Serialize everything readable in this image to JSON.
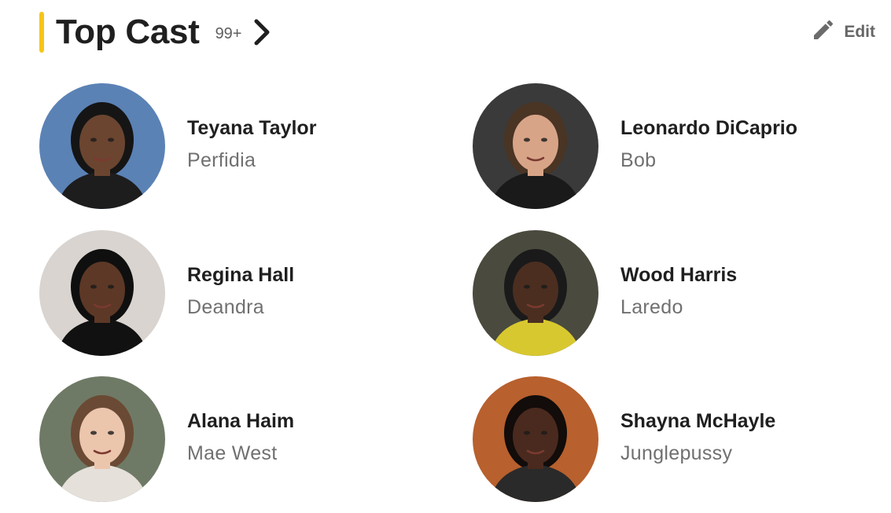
{
  "section": {
    "title": "Top Cast",
    "count": "99+",
    "edit_label": "Edit",
    "accent_color": "#f5c518"
  },
  "cast": [
    {
      "name": "Teyana Taylor",
      "role": "Perfidia",
      "bg": "#5b82b5",
      "skin": "#6b4530",
      "hair": "#151515",
      "cloth": "#1d1d1d"
    },
    {
      "name": "Leonardo DiCaprio",
      "role": "Bob",
      "bg": "#3a3a3a",
      "skin": "#d8a488",
      "hair": "#4a3424",
      "cloth": "#1a1a1a"
    },
    {
      "name": "Regina Hall",
      "role": "Deandra",
      "bg": "#d9d4d0",
      "skin": "#5d3826",
      "hair": "#0f0f0f",
      "cloth": "#111111"
    },
    {
      "name": "Wood Harris",
      "role": "Laredo",
      "bg": "#4a4a3e",
      "skin": "#4b2e20",
      "hair": "#1a1a1a",
      "cloth": "#d8c830"
    },
    {
      "name": "Alana Haim",
      "role": "Mae West",
      "bg": "#6f7a66",
      "skin": "#ecc5ad",
      "hair": "#6a4a34",
      "cloth": "#e5e0da"
    },
    {
      "name": "Shayna McHayle",
      "role": "Junglepussy",
      "bg": "#b8602e",
      "skin": "#4a2a1e",
      "hair": "#120c0a",
      "cloth": "#2a2a2a"
    }
  ]
}
